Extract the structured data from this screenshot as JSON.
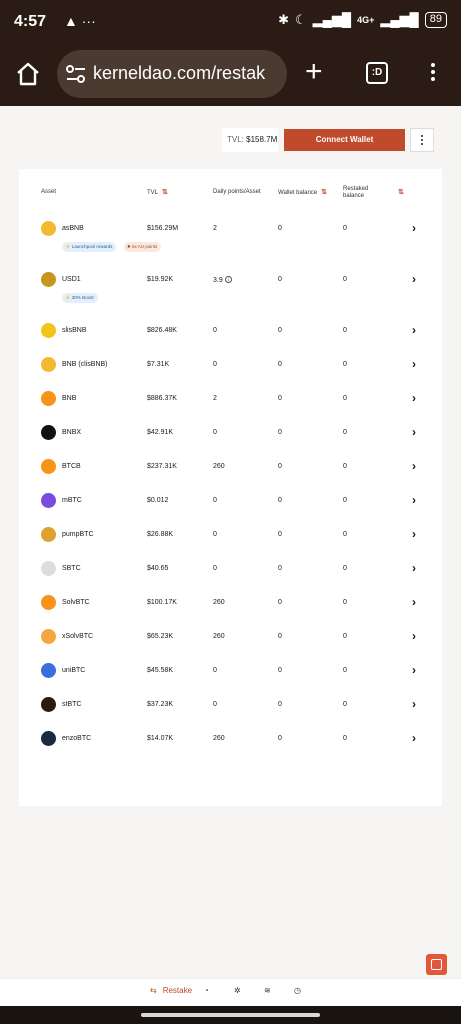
{
  "status": {
    "time": "4:57",
    "battery": "89",
    "network": "4G+"
  },
  "browser": {
    "url": "kerneldao.com/restak",
    "tab_label": ":D"
  },
  "header": {
    "tvl_label": "TVL:",
    "tvl_value": "$158.7M",
    "connect_label": "Connect Wallet"
  },
  "table": {
    "headers": {
      "asset": "Asset",
      "tvl": "TVL",
      "daily": "Daily points/Asset",
      "wallet": "Wallet balance",
      "restaked": "Restaked balance"
    },
    "rows": [
      {
        "asset": "asBNB",
        "tvl": "$156.29M",
        "daily": "2",
        "wallet": "0",
        "restaked": "0",
        "icon_color": "#f3ba2f",
        "badges": [
          "Launchpool rewards",
          "5x AU points"
        ]
      },
      {
        "asset": "USD1",
        "tvl": "$19.92K",
        "daily": "3.9",
        "wallet": "0",
        "restaked": "0",
        "icon_color": "#c8961e",
        "badges": [
          "30% Boost"
        ],
        "daily_info": "i"
      },
      {
        "asset": "slisBNB",
        "tvl": "$826.48K",
        "daily": "0",
        "wallet": "0",
        "restaked": "0",
        "icon_color": "#f0c419"
      },
      {
        "asset": "BNB (clisBNB)",
        "tvl": "$7.31K",
        "daily": "0",
        "wallet": "0",
        "restaked": "0",
        "icon_color": "#f3ba2f"
      },
      {
        "asset": "BNB",
        "tvl": "$886.37K",
        "daily": "2",
        "wallet": "0",
        "restaked": "0",
        "icon_color": "#f7931a"
      },
      {
        "asset": "BNBX",
        "tvl": "$42.91K",
        "daily": "0",
        "wallet": "0",
        "restaked": "0",
        "icon_color": "#111111"
      },
      {
        "asset": "BTCB",
        "tvl": "$237.31K",
        "daily": "260",
        "wallet": "0",
        "restaked": "0",
        "icon_color": "#f7931a"
      },
      {
        "asset": "mBTC",
        "tvl": "$0.012",
        "daily": "0",
        "wallet": "0",
        "restaked": "0",
        "icon_color": "#7b4be0"
      },
      {
        "asset": "pumpBTC",
        "tvl": "$26.88K",
        "daily": "0",
        "wallet": "0",
        "restaked": "0",
        "icon_color": "#e0a030"
      },
      {
        "asset": "SBTC",
        "tvl": "$40.65",
        "daily": "0",
        "wallet": "0",
        "restaked": "0",
        "icon_color": "#dddddd"
      },
      {
        "asset": "SolvBTC",
        "tvl": "$100.17K",
        "daily": "260",
        "wallet": "0",
        "restaked": "0",
        "icon_color": "#f7931a"
      },
      {
        "asset": "xSolvBTC",
        "tvl": "$65.23K",
        "daily": "260",
        "wallet": "0",
        "restaked": "0",
        "icon_color": "#f4a640"
      },
      {
        "asset": "uniBTC",
        "tvl": "$45.58K",
        "daily": "0",
        "wallet": "0",
        "restaked": "0",
        "icon_color": "#3b6fe0"
      },
      {
        "asset": "stBTC",
        "tvl": "$37.23K",
        "daily": "0",
        "wallet": "0",
        "restaked": "0",
        "icon_color": "#2a1a10"
      },
      {
        "asset": "enzoBTC",
        "tvl": "$14.07K",
        "daily": "260",
        "wallet": "0",
        "restaked": "0",
        "icon_color": "#1a2a40"
      }
    ]
  },
  "nav": {
    "restake_label": "Restake"
  },
  "colors": {
    "accent": "#c04a2c",
    "chrome": "#2a1c14"
  }
}
